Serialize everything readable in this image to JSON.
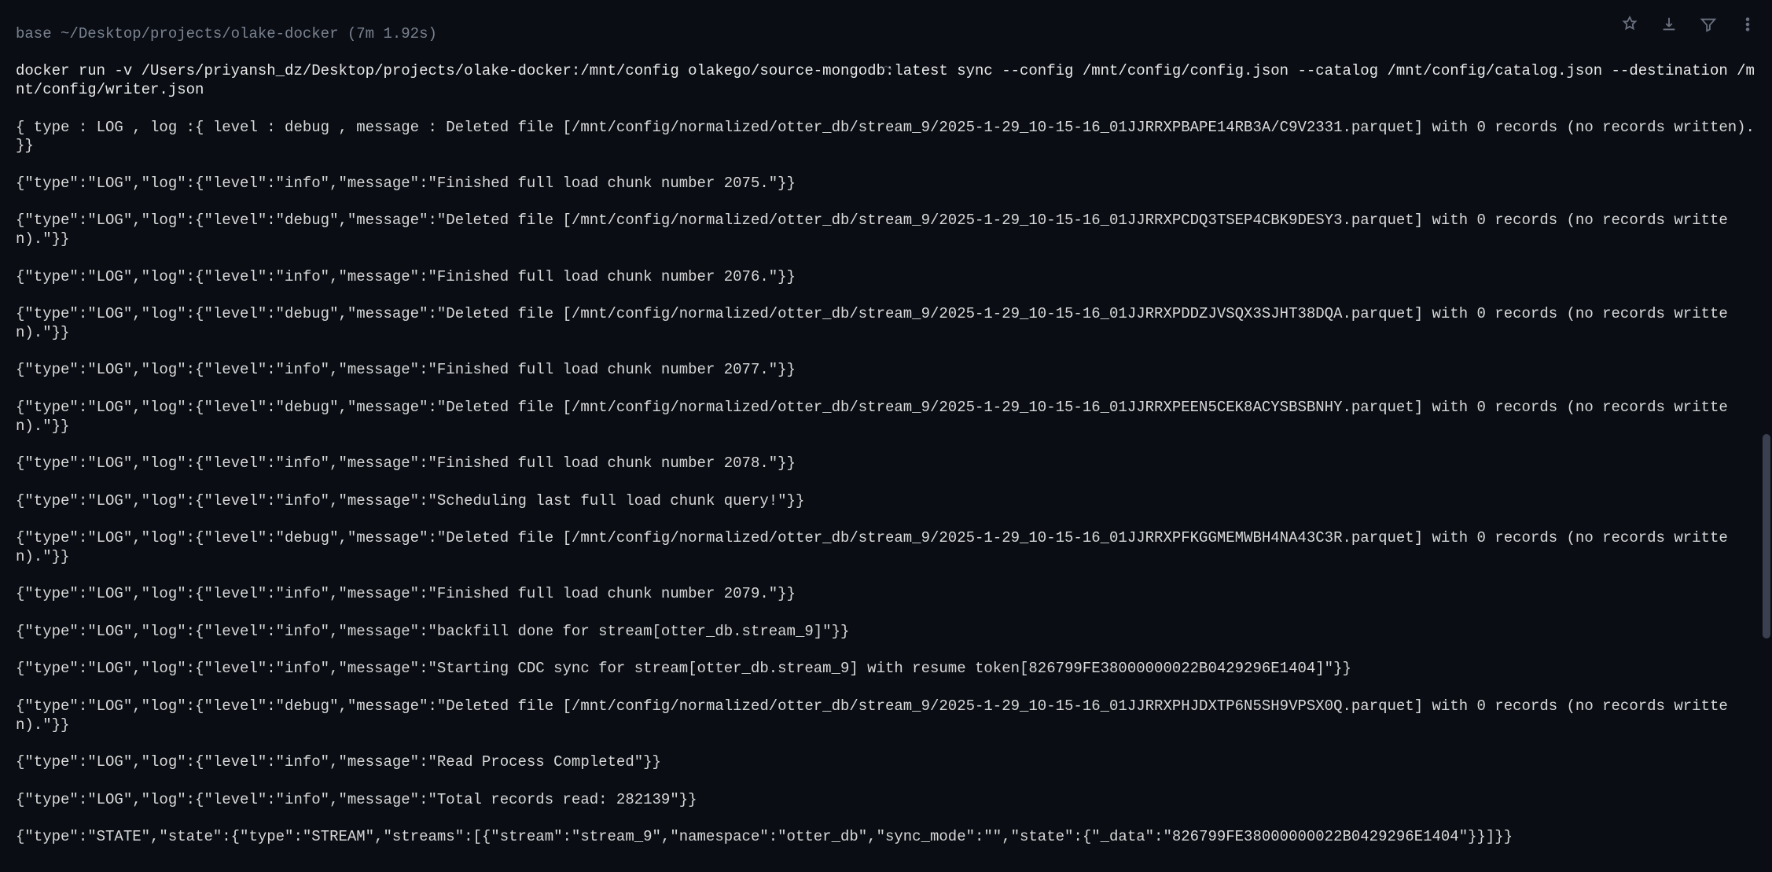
{
  "prompt": "base ~/Desktop/projects/olake-docker (7m 1.92s)",
  "command": "docker run -v /Users/priyansh_dz/Desktop/projects/olake-docker:/mnt/config olakego/source-mongodb:latest sync --config /mnt/config/config.json --catalog /mnt/config/catalog.json --destination /mnt/config/writer.json",
  "logs": [
    "{ type : LOG , log :{ level : debug , message : Deleted file [/mnt/config/normalized/otter_db/stream_9/2025-1-29_10-15-16_01JJRRXPBAPE14RB3A/C9V2331.parquet] with 0 records (no records written). }}",
    "{\"type\":\"LOG\",\"log\":{\"level\":\"info\",\"message\":\"Finished full load chunk number 2075.\"}}",
    "{\"type\":\"LOG\",\"log\":{\"level\":\"debug\",\"message\":\"Deleted file [/mnt/config/normalized/otter_db/stream_9/2025-1-29_10-15-16_01JJRRXPCDQ3TSEP4CBK9DESY3.parquet] with 0 records (no records written).\"}}",
    "{\"type\":\"LOG\",\"log\":{\"level\":\"info\",\"message\":\"Finished full load chunk number 2076.\"}}",
    "{\"type\":\"LOG\",\"log\":{\"level\":\"debug\",\"message\":\"Deleted file [/mnt/config/normalized/otter_db/stream_9/2025-1-29_10-15-16_01JJRRXPDDZJVSQX3SJHT38DQA.parquet] with 0 records (no records written).\"}}",
    "{\"type\":\"LOG\",\"log\":{\"level\":\"info\",\"message\":\"Finished full load chunk number 2077.\"}}",
    "{\"type\":\"LOG\",\"log\":{\"level\":\"debug\",\"message\":\"Deleted file [/mnt/config/normalized/otter_db/stream_9/2025-1-29_10-15-16_01JJRRXPEEN5CEK8ACYSBSBNHY.parquet] with 0 records (no records written).\"}}",
    "{\"type\":\"LOG\",\"log\":{\"level\":\"info\",\"message\":\"Finished full load chunk number 2078.\"}}",
    "{\"type\":\"LOG\",\"log\":{\"level\":\"info\",\"message\":\"Scheduling last full load chunk query!\"}}",
    "{\"type\":\"LOG\",\"log\":{\"level\":\"debug\",\"message\":\"Deleted file [/mnt/config/normalized/otter_db/stream_9/2025-1-29_10-15-16_01JJRRXPFKGGMEMWBH4NA43C3R.parquet] with 0 records (no records written).\"}}",
    "{\"type\":\"LOG\",\"log\":{\"level\":\"info\",\"message\":\"Finished full load chunk number 2079.\"}}",
    "{\"type\":\"LOG\",\"log\":{\"level\":\"info\",\"message\":\"backfill done for stream[otter_db.stream_9]\"}}",
    "{\"type\":\"LOG\",\"log\":{\"level\":\"info\",\"message\":\"Starting CDC sync for stream[otter_db.stream_9] with resume token[826799FE38000000022B0429296E1404]\"}}",
    "{\"type\":\"LOG\",\"log\":{\"level\":\"debug\",\"message\":\"Deleted file [/mnt/config/normalized/otter_db/stream_9/2025-1-29_10-15-16_01JJRRXPHJDXTP6N5SH9VPSX0Q.parquet] with 0 records (no records written).\"}}",
    "{\"type\":\"LOG\",\"log\":{\"level\":\"info\",\"message\":\"Read Process Completed\"}}",
    "{\"type\":\"LOG\",\"log\":{\"level\":\"info\",\"message\":\"Total records read: 282139\"}}",
    "{\"type\":\"STATE\",\"state\":{\"type\":\"STREAM\",\"streams\":[{\"stream\":\"stream_9\",\"namespace\":\"otter_db\",\"sync_mode\":\"\",\"state\":{\"_data\":\"826799FE38000000022B0429296E1404\"}}]}}"
  ]
}
